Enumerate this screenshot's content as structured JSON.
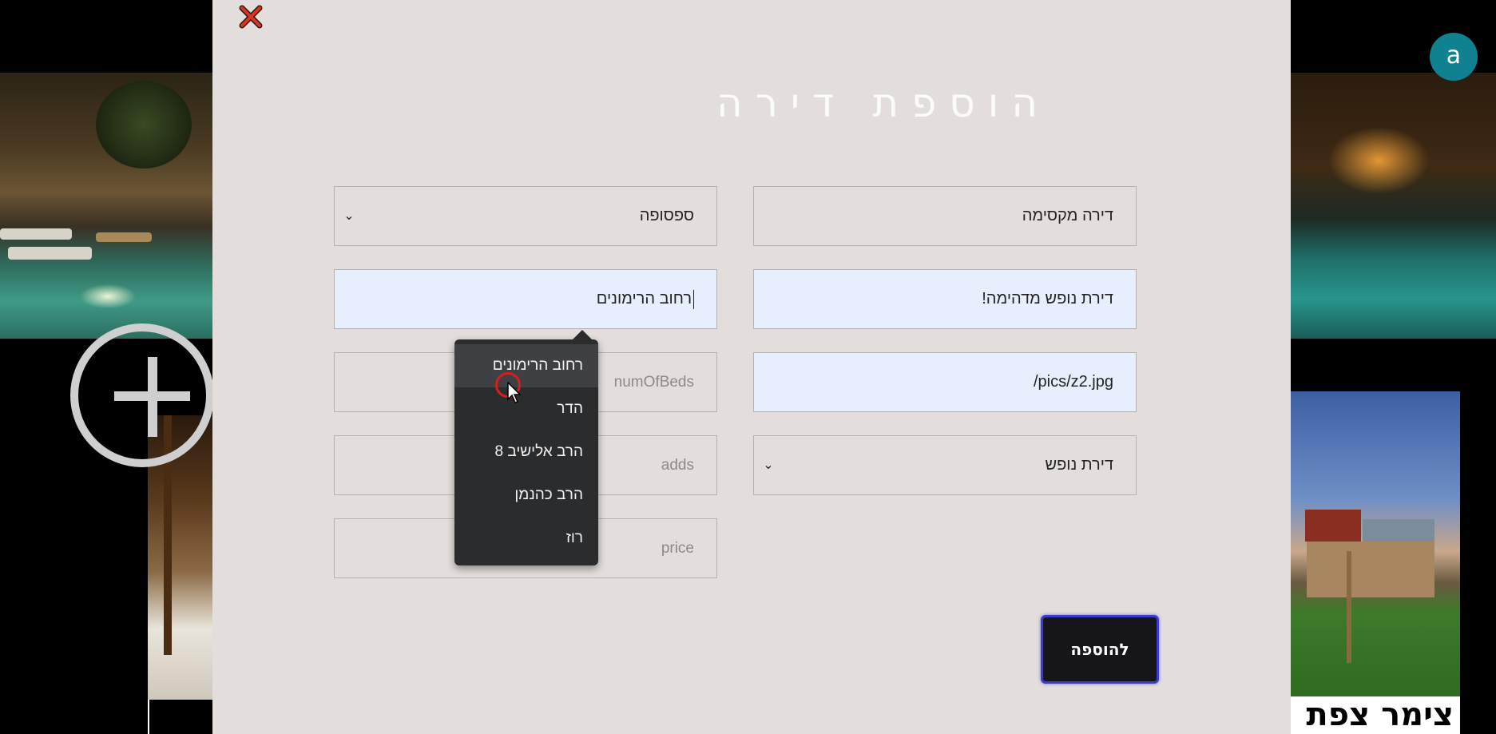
{
  "modal": {
    "title": "הוספת דירה",
    "close_icon": "close-icon"
  },
  "form": {
    "name_value": "דירה מקסימה",
    "city_value": "ספסופה",
    "description_value": "דירת נופש מדהימה!",
    "address_value": "רחוב הרימונים",
    "image_value": "pics/z2.jpg/",
    "num_beds_placeholder": "numOfBeds",
    "category_value": "דירת נופש",
    "adds_placeholder": "adds",
    "price_placeholder": "price",
    "submit_label": "להוספה"
  },
  "autocomplete": {
    "items": [
      "רחוב הרימונים",
      "הדר",
      "הרב אלישיב 8",
      "הרב כהנמן",
      "רוז"
    ],
    "highlighted_index": 0
  },
  "background": {
    "card_title": "צימר צפת",
    "avatar_letter": "a"
  },
  "colors": {
    "modal_bg": "#e3dedb",
    "filled_field_bg": "#e7efff",
    "avatar_bg": "#0f8190",
    "submit_border": "#3c3cc8",
    "close_icon": "#e0321f"
  }
}
